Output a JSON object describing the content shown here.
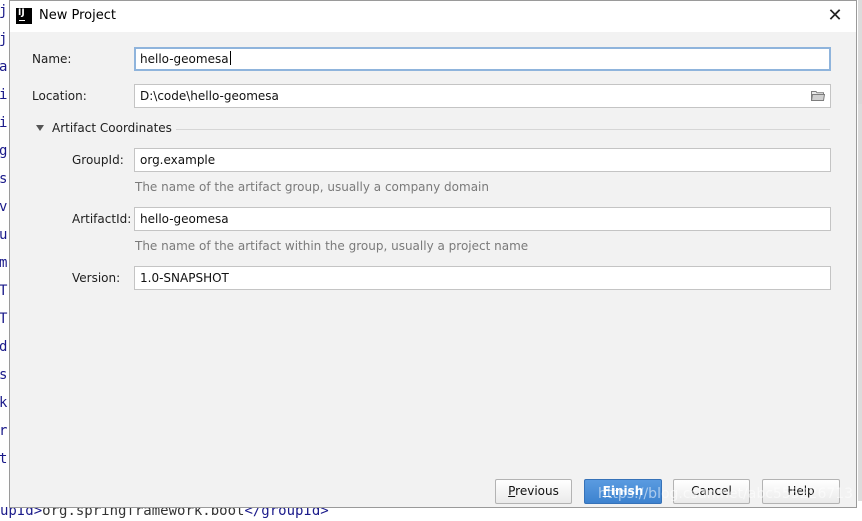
{
  "dialog": {
    "title": "New Project",
    "icon": "intellij-logo",
    "close_glyph": "✕"
  },
  "form": {
    "name_label": "Name:",
    "name_value": "hello-geomesa",
    "location_label": "Location:",
    "location_value": "D:\\code\\hello-geomesa",
    "section_title": "Artifact Coordinates",
    "groupid_label": "GroupId:",
    "groupid_value": "org.example",
    "groupid_hint": "The name of the artifact group, usually a company domain",
    "artifactid_label": "ArtifactId:",
    "artifactid_value": "hello-geomesa",
    "artifactid_hint": "The name of the artifact within the group, usually a project name",
    "version_label": "Version:",
    "version_value": "1.0-SNAPSHOT"
  },
  "buttons": {
    "previous_mnemonic": "P",
    "previous_rest": "revious",
    "finish_mnemonic": "F",
    "finish_rest": "inish",
    "cancel": "Cancel",
    "help": "Help"
  },
  "background": {
    "left_chars": [
      "j",
      "j",
      "a",
      "i",
      "i",
      "g",
      "s",
      "v",
      "u",
      "m",
      "T",
      "T",
      "d",
      "s",
      "k",
      "r",
      "t"
    ],
    "bottom_open_tag": "upId>",
    "bottom_text": "org.springframework.boot",
    "bottom_close_tag": "</groupId>"
  },
  "watermark": "https://blog.csdn.net/abc555226713"
}
